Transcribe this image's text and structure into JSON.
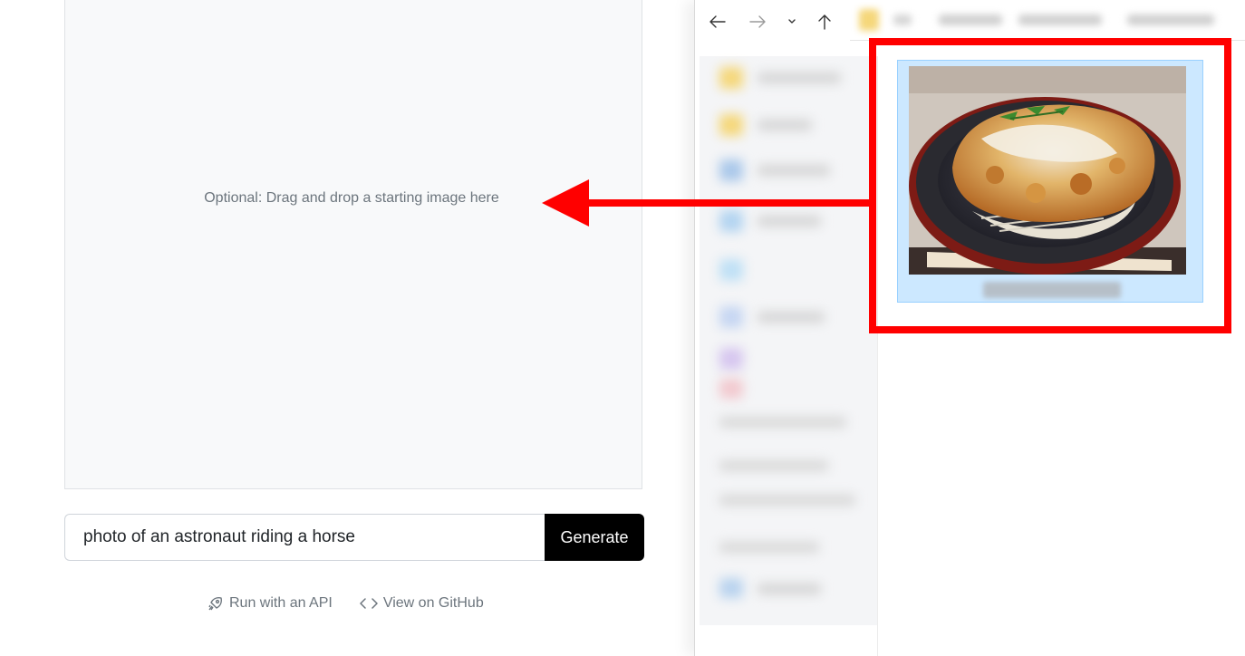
{
  "app": {
    "dropzone_text": "Optional: Drag and drop a starting image here",
    "prompt_value": "photo of an astronaut riding a horse",
    "generate_label": "Generate",
    "links": [
      {
        "label": "Run with an API",
        "icon": "rocket-icon"
      },
      {
        "label": "View on GitHub",
        "icon": "code-icon"
      }
    ]
  },
  "explorer": {
    "nav_icons": [
      "back-arrow-icon",
      "forward-arrow-icon",
      "recent-locations-chevron-icon",
      "up-arrow-icon"
    ],
    "selected_file_thumbnail": "food-photo-thumbnail"
  },
  "annotation": {
    "highlight_color": "#ff0000",
    "arrow_color": "#ff0000"
  }
}
